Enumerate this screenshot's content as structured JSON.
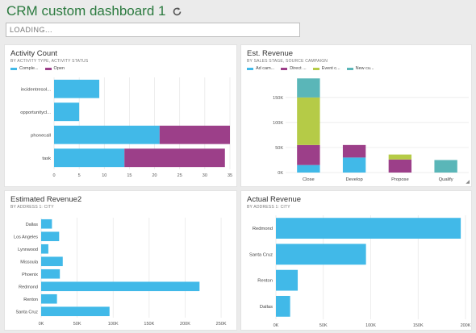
{
  "header": {
    "title": "CRM custom dashboard 1",
    "refresh_icon": "refresh-icon"
  },
  "search": {
    "placeholder": "LOADING..."
  },
  "colors": {
    "blue": "#41b9e8",
    "purple": "#9c3f89",
    "olive": "#b5cb47",
    "teal": "#5ab6b8"
  },
  "panels": {
    "activity": {
      "title": "Activity Count",
      "subtitle": "BY ACTIVITY TYPE, ACTIVITY STATUS",
      "legend": [
        "Comple...",
        "Open"
      ]
    },
    "est_revenue": {
      "title": "Est. Revenue",
      "subtitle": "BY SALES STAGE, SOURCE CAMPAIGN",
      "legend": [
        "Ad cam...",
        "Direct ...",
        "Event c...",
        "New cu..."
      ]
    },
    "est_revenue2": {
      "title": "Estimated Revenue2",
      "subtitle": "BY ADDRESS 1: CITY"
    },
    "actual_revenue": {
      "title": "Actual Revenue",
      "subtitle": "BY ADDRESS 1: CITY"
    }
  },
  "chart_data": [
    {
      "id": "activity",
      "type": "bar",
      "orientation": "horizontal",
      "stacked": true,
      "categories": [
        "incidentresol...",
        "opportunitycl...",
        "phonecall",
        "task"
      ],
      "series": [
        {
          "name": "Comple...",
          "values": [
            9,
            5,
            21,
            14
          ]
        },
        {
          "name": "Open",
          "values": [
            0,
            0,
            14,
            20
          ]
        }
      ],
      "ticks": [
        "0",
        "5",
        "10",
        "15",
        "20",
        "25",
        "30",
        "35"
      ],
      "xlim": [
        0,
        35
      ]
    },
    {
      "id": "est_revenue",
      "type": "bar",
      "orientation": "vertical",
      "stacked": true,
      "categories": [
        "Close",
        "Develop",
        "Propose",
        "Qualify"
      ],
      "series": [
        {
          "name": "Ad cam...",
          "values": [
            15000,
            30000,
            0,
            0
          ]
        },
        {
          "name": "Direct ...",
          "values": [
            40000,
            25000,
            26000,
            0
          ]
        },
        {
          "name": "Event c...",
          "values": [
            95000,
            0,
            10000,
            0
          ]
        },
        {
          "name": "New cu...",
          "values": [
            38000,
            0,
            0,
            25000
          ]
        }
      ],
      "ticks": [
        "0K",
        "50K",
        "100K",
        "150K"
      ],
      "ylim": [
        0,
        190000
      ]
    },
    {
      "id": "est_revenue2",
      "type": "bar",
      "orientation": "horizontal",
      "categories": [
        "Dallas",
        "Los Angeles",
        "Lynnwood",
        "Missoula",
        "Phoenix",
        "Redmond",
        "Renton",
        "Santa Cruz"
      ],
      "values": [
        15000,
        25000,
        10000,
        30000,
        26000,
        220000,
        22000,
        95000
      ],
      "ticks": [
        "0K",
        "50K",
        "100K",
        "150K",
        "200K",
        "250K"
      ],
      "xlim": [
        0,
        260000
      ]
    },
    {
      "id": "actual_revenue",
      "type": "bar",
      "orientation": "horizontal",
      "categories": [
        "Redmond",
        "Santa Cruz",
        "Renton",
        "Dallas"
      ],
      "values": [
        195000,
        95000,
        23000,
        15000
      ],
      "ticks": [
        "0K",
        "50K",
        "100K",
        "150K",
        "200K"
      ],
      "xlim": [
        0,
        200000
      ]
    }
  ]
}
